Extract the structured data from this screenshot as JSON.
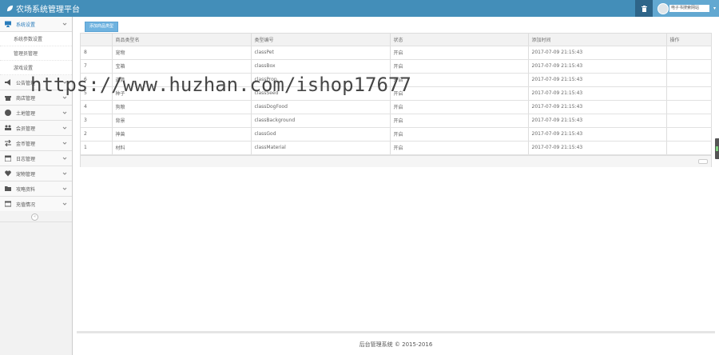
{
  "header": {
    "title": "农场系统管理平台",
    "user_name": "电子书搜索网站",
    "icons": {
      "brand": "leaf-icon",
      "trash": "trash-icon",
      "caret": "caret-down-icon"
    },
    "colors": {
      "bar": "#438eb9",
      "trash_bg": "#2e6589",
      "user_bg": "#62a8d1"
    }
  },
  "sidebar": {
    "items": [
      {
        "label": "系统设置",
        "icon": "desktop-icon",
        "active": true
      },
      {
        "label": "公告管理",
        "icon": "bullhorn-icon"
      },
      {
        "label": "商店管理",
        "icon": "gift-icon"
      },
      {
        "label": "土地管理",
        "icon": "globe-icon"
      },
      {
        "label": "会员管理",
        "icon": "users-icon"
      },
      {
        "label": "金币管理",
        "icon": "exchange-icon"
      },
      {
        "label": "日志管理",
        "icon": "calendar-icon"
      },
      {
        "label": "宠物管理",
        "icon": "heart-icon"
      },
      {
        "label": "攻略资料",
        "icon": "folder-icon"
      },
      {
        "label": "充值情况",
        "icon": "list-icon"
      }
    ],
    "subitems": [
      {
        "label": "系统参数设置"
      },
      {
        "label": "管理员管理"
      },
      {
        "label": "游戏设置"
      }
    ],
    "collapse_icon": "double-angle-left-icon"
  },
  "main": {
    "add_button": "添加商品类型",
    "table": {
      "columns": [
        "",
        "商品类型名",
        "类型编号",
        "状态",
        "添加时间",
        "操作"
      ],
      "rows": [
        {
          "id": "8",
          "name": "宠物",
          "code": "classPet",
          "status": "开启",
          "time": "2017-07-09 21:15:43"
        },
        {
          "id": "7",
          "name": "宝箱",
          "code": "classBox",
          "status": "开启",
          "time": "2017-07-09 21:15:43"
        },
        {
          "id": "6",
          "name": "道具",
          "code": "classProp",
          "status": "开启",
          "time": "2017-07-09 21:15:43"
        },
        {
          "id": "5",
          "name": "种子",
          "code": "classSeed",
          "status": "开启",
          "time": "2017-07-09 21:15:43"
        },
        {
          "id": "4",
          "name": "狗粮",
          "code": "classDogFood",
          "status": "开启",
          "time": "2017-07-09 21:15:43"
        },
        {
          "id": "3",
          "name": "背景",
          "code": "classBackground",
          "status": "开启",
          "time": "2017-07-09 21:15:43"
        },
        {
          "id": "2",
          "name": "神兽",
          "code": "classGod",
          "status": "开启",
          "time": "2017-07-09 21:15:43"
        },
        {
          "id": "1",
          "name": "材料",
          "code": "classMaterial",
          "status": "开启",
          "time": "2017-07-09 21:15:43"
        }
      ]
    }
  },
  "watermark": "https://www.huzhan.com/ishop17677",
  "footer": {
    "text": "后台管理系统 © 2015-2016"
  }
}
